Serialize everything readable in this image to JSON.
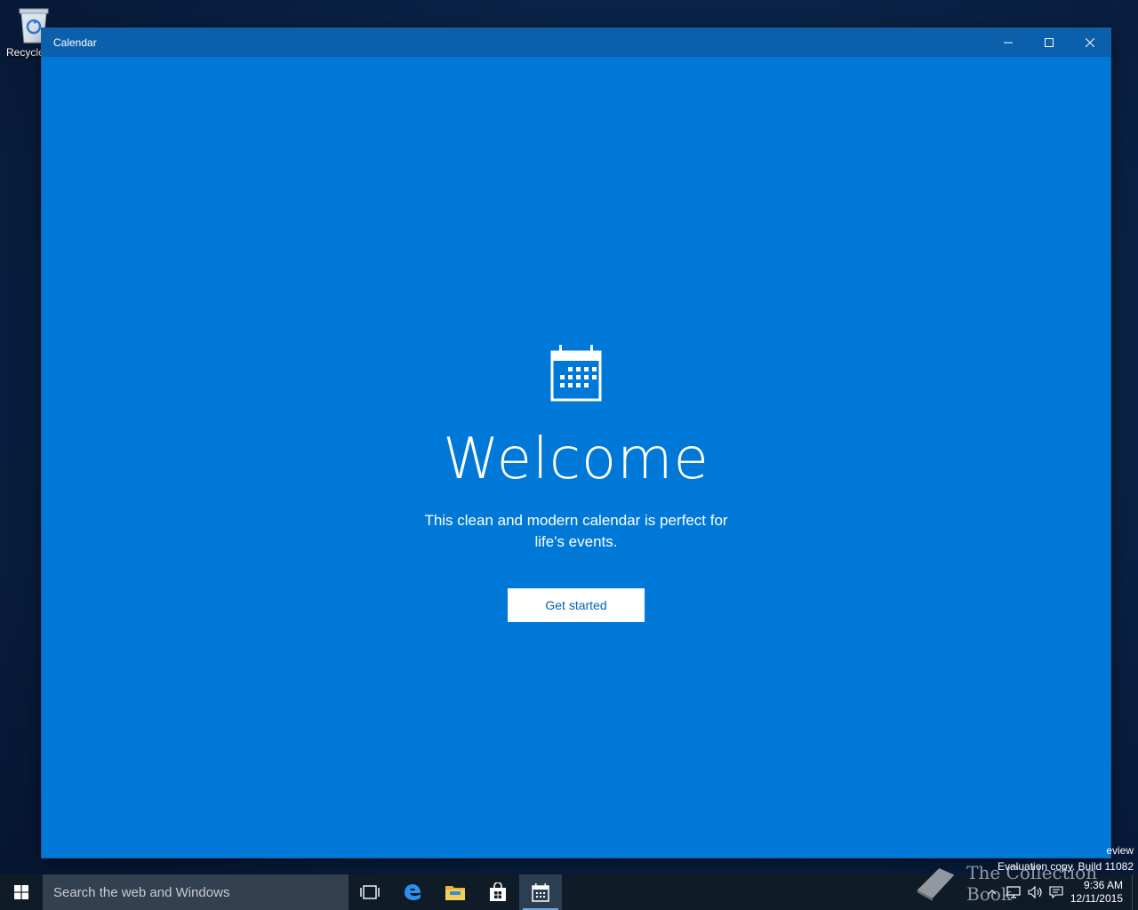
{
  "desktop": {
    "recycle_bin_label": "Recycle"
  },
  "window": {
    "title": "Calendar",
    "controls": {
      "minimize": "minimize-icon",
      "maximize": "maximize-icon",
      "close": "close-icon"
    }
  },
  "welcome": {
    "headline": "Welcome",
    "subtitle": "This clean and modern calendar is perfect for life's events.",
    "button_label": "Get started"
  },
  "watermark": {
    "line1": "eview",
    "line2": "Evaluation copy. Build 11082",
    "brand": "The Collection Book"
  },
  "taskbar": {
    "search_placeholder": "Search the web and Windows",
    "apps": [
      "task-view-icon",
      "edge-icon",
      "file-explorer-icon",
      "store-icon",
      "calendar-icon"
    ],
    "clock": {
      "time": "9:36 AM",
      "date": "12/11/2015"
    }
  },
  "colors": {
    "app_accent": "#0078d7",
    "titlebar": "#0b5fab",
    "taskbar": "#101b28",
    "button_text": "#0063b1"
  }
}
